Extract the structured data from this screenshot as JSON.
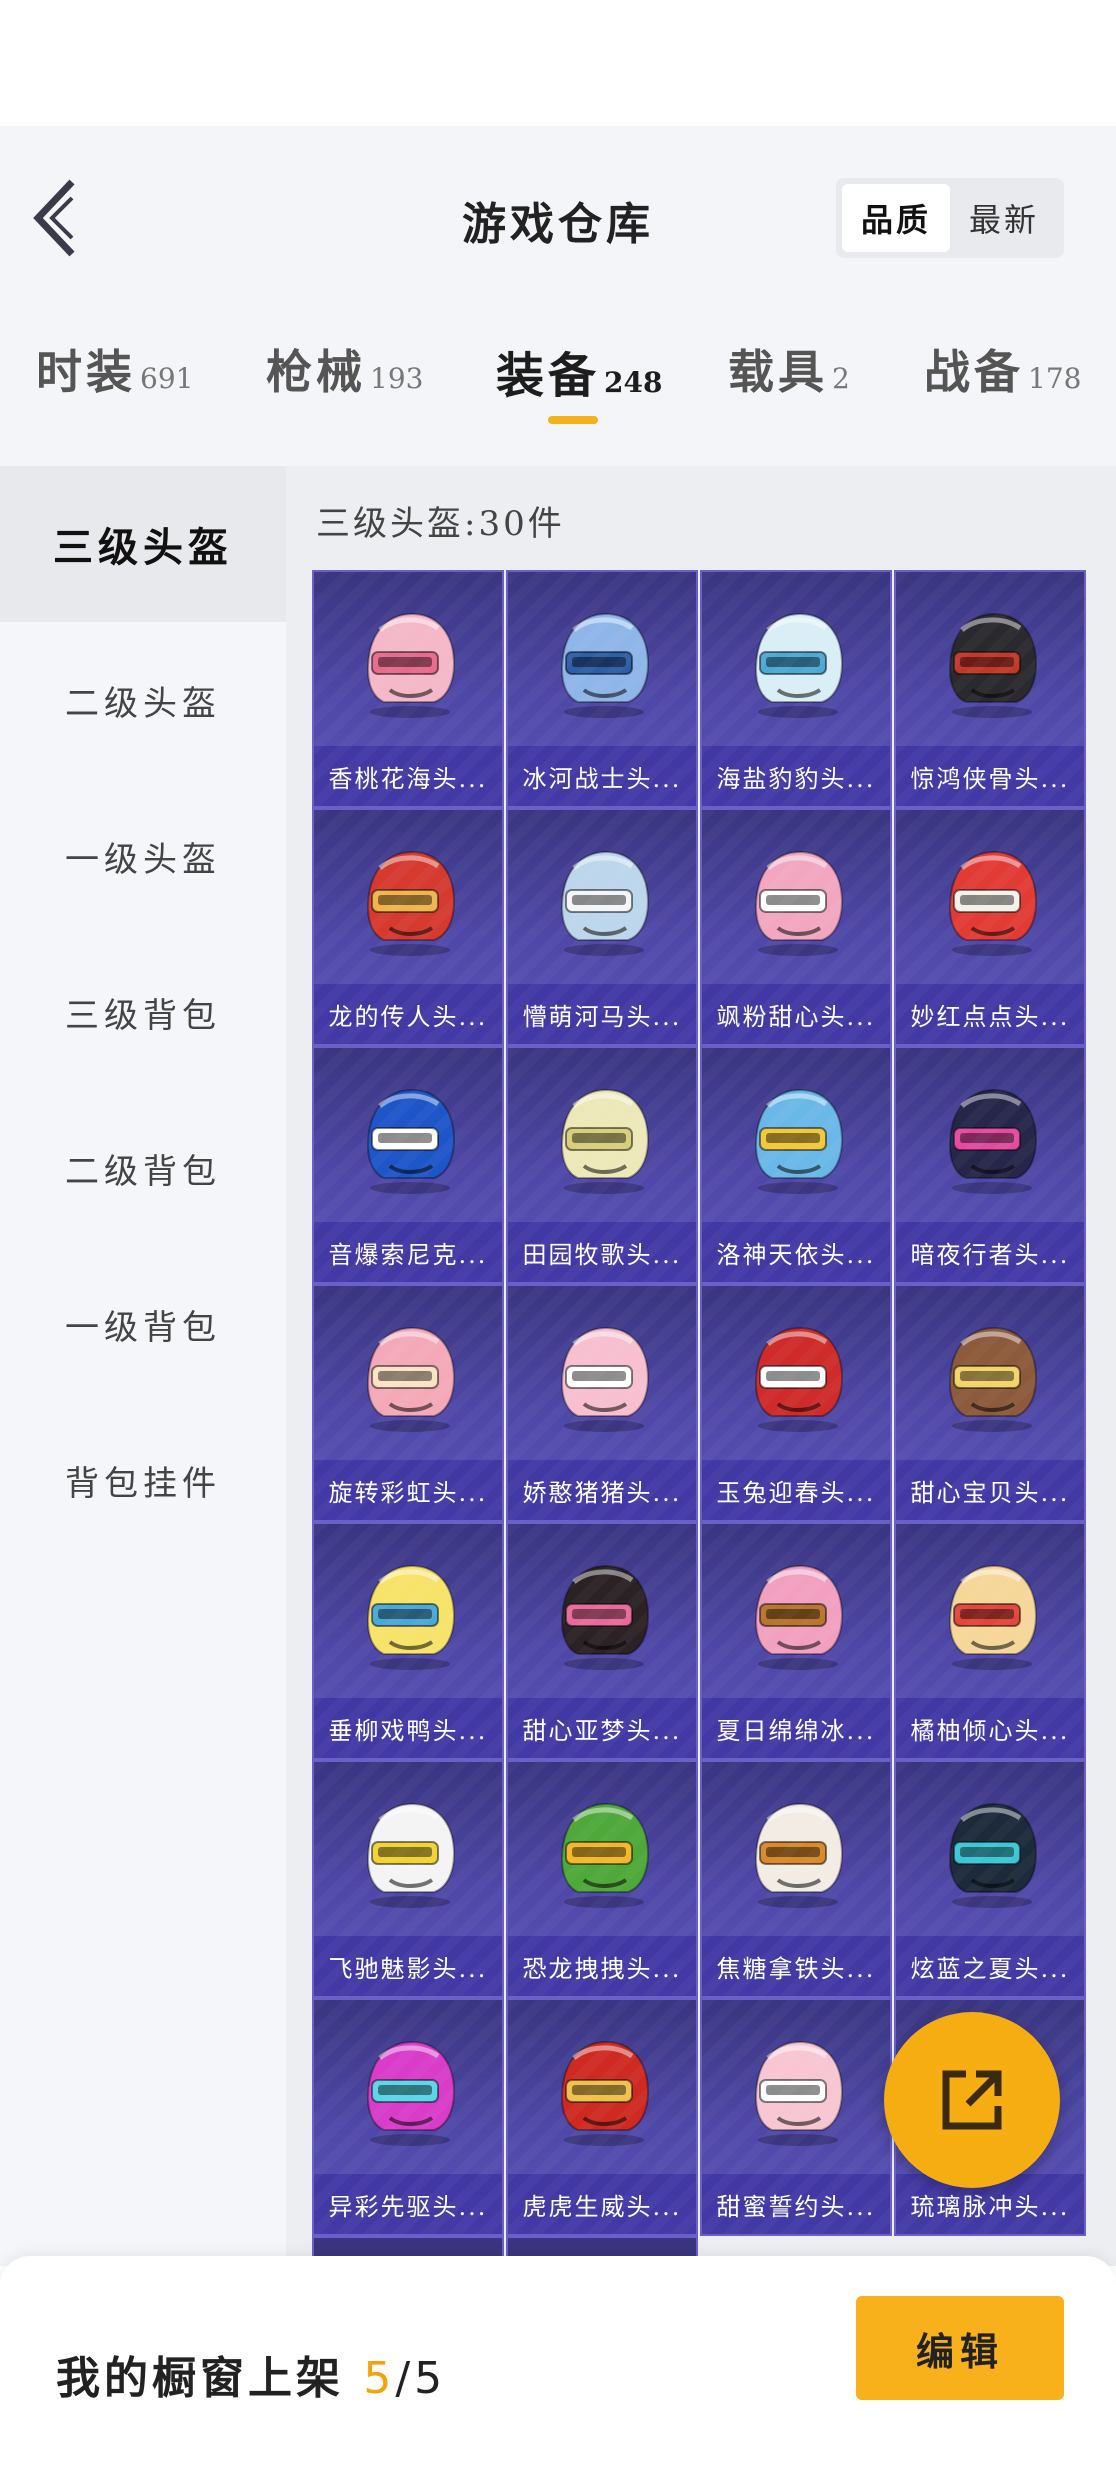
{
  "header": {
    "title": "游戏仓库",
    "sort_options": [
      {
        "label": "品质",
        "active": true
      },
      {
        "label": "最新",
        "active": false
      }
    ]
  },
  "tabs": [
    {
      "label": "时装",
      "count": "691",
      "active": false
    },
    {
      "label": "枪械",
      "count": "193",
      "active": false
    },
    {
      "label": "装备",
      "count": "248",
      "active": true
    },
    {
      "label": "载具",
      "count": "2",
      "active": false
    },
    {
      "label": "战备",
      "count": "178",
      "active": false
    }
  ],
  "sidebar": {
    "items": [
      {
        "label": "三级头盔",
        "active": true
      },
      {
        "label": "二级头盔",
        "active": false
      },
      {
        "label": "一级头盔",
        "active": false
      },
      {
        "label": "三级背包",
        "active": false
      },
      {
        "label": "二级背包",
        "active": false
      },
      {
        "label": "一级背包",
        "active": false
      },
      {
        "label": "背包挂件",
        "active": false
      }
    ]
  },
  "main": {
    "section_title": "三级头盔:30件",
    "items": [
      {
        "name": "香桃花海头...",
        "color": "#f4b8c8",
        "accent": "#e86a8c"
      },
      {
        "name": "冰河战士头...",
        "color": "#8fb6e8",
        "accent": "#2f5ea8"
      },
      {
        "name": "海盐豹豹头...",
        "color": "#d9eef6",
        "accent": "#4ca9d6"
      },
      {
        "name": "惊鸿侠骨头...",
        "color": "#2a2a2e",
        "accent": "#c0392b"
      },
      {
        "name": "龙的传人头...",
        "color": "#d63a2f",
        "accent": "#f0b44c"
      },
      {
        "name": "懵萌河马头...",
        "color": "#bcd6ec",
        "accent": "#f3f6f8"
      },
      {
        "name": "飒粉甜心头...",
        "color": "#f2a6c0",
        "accent": "#ffffff"
      },
      {
        "name": "妙红点点头...",
        "color": "#e23b35",
        "accent": "#f4f0ea"
      },
      {
        "name": "音爆索尼克...",
        "color": "#1e56c8",
        "accent": "#ffffff"
      },
      {
        "name": "田园牧歌头...",
        "color": "#ece8b8",
        "accent": "#d7cf7c"
      },
      {
        "name": "洛神天依头...",
        "color": "#6ab8e8",
        "accent": "#f2c83c"
      },
      {
        "name": "暗夜行者头...",
        "color": "#26264a",
        "accent": "#e44aa0"
      },
      {
        "name": "旋转彩虹头...",
        "color": "#f4a8b8",
        "accent": "#fbe2c6"
      },
      {
        "name": "娇憨猪猪头...",
        "color": "#f7bfd0",
        "accent": "#ffffff"
      },
      {
        "name": "玉兔迎春头...",
        "color": "#cf2b2b",
        "accent": "#ffffff"
      },
      {
        "name": "甜心宝贝头...",
        "color": "#8c5a3c",
        "accent": "#f3d36a"
      },
      {
        "name": "垂柳戏鸭头...",
        "color": "#f7e36a",
        "accent": "#4aa8d8"
      },
      {
        "name": "甜心亚梦头...",
        "color": "#2b2226",
        "accent": "#e86a9a"
      },
      {
        "name": "夏日绵绵冰...",
        "color": "#f2a0c0",
        "accent": "#b7752e"
      },
      {
        "name": "橘柚倾心头...",
        "color": "#f6d79a",
        "accent": "#e3463c"
      },
      {
        "name": "飞驰魅影头...",
        "color": "#f4f4f4",
        "accent": "#f1d238"
      },
      {
        "name": "恐龙拽拽头...",
        "color": "#4fa83a",
        "accent": "#f3b82a"
      },
      {
        "name": "焦糖拿铁头...",
        "color": "#f3ece4",
        "accent": "#d8892c"
      },
      {
        "name": "炫蓝之夏头...",
        "color": "#1d2a3a",
        "accent": "#3cc6d8"
      },
      {
        "name": "异彩先驱头...",
        "color": "#d83cc8",
        "accent": "#5ad6e8"
      },
      {
        "name": "虎虎生威头...",
        "color": "#cf2a22",
        "accent": "#f1c04c"
      },
      {
        "name": "甜蜜誓约头...",
        "color": "#f7c6d2",
        "accent": "#ffffff"
      },
      {
        "name": "琉璃脉冲头...",
        "color": "#4a4d86",
        "accent": "#6cd6f0"
      }
    ]
  },
  "showcase": {
    "label": "我的橱窗上架 ",
    "count": "5",
    "separator": "/",
    "total": "5",
    "edit_label": "编辑"
  },
  "icons": {
    "back": "chevron-left-icon",
    "share": "share-external-icon"
  },
  "colors": {
    "accent": "#f8b11b",
    "card_purple": "#4f48a8"
  }
}
